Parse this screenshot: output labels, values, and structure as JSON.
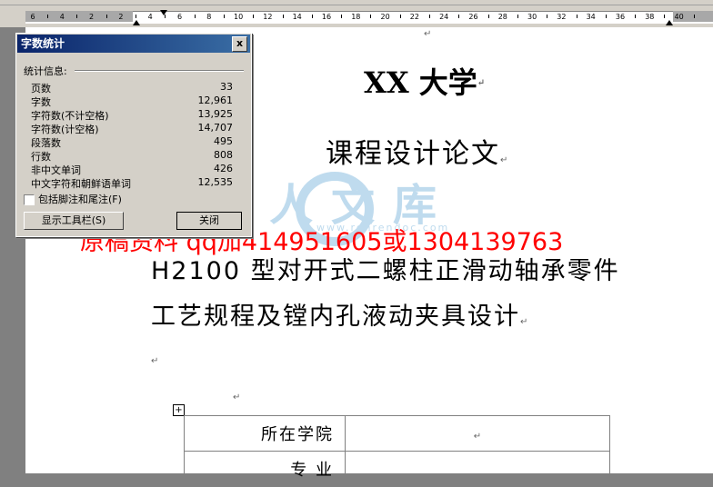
{
  "ruler": {
    "ticks": [
      "6",
      "4",
      "2",
      "2",
      "4",
      "6",
      "8",
      "10",
      "12",
      "14",
      "16",
      "18",
      "20",
      "22",
      "24",
      "26",
      "28",
      "30",
      "32",
      "34",
      "36",
      "38",
      "40"
    ]
  },
  "document": {
    "title_1": "XX 大学",
    "title_2": "课程设计论文",
    "watermark": "人人文库",
    "watermark_url": "www.renrendoc.com",
    "red_banner": "原稿资料  qq加414951605或1304139763",
    "subtitle_1": "H2100 型对开式二螺柱正滑动轴承零件",
    "subtitle_2": "工艺规程及镗内孔液动夹具设计",
    "table": {
      "rows": [
        {
          "label": "所在学院",
          "value": ""
        },
        {
          "label": "专    业",
          "value": ""
        }
      ]
    },
    "para_mark": "↵",
    "table_anchor": "+"
  },
  "dialog": {
    "title": "字数统计",
    "close_glyph": "x",
    "caption": "统计信息:",
    "stats": [
      {
        "label": "页数",
        "value": "33"
      },
      {
        "label": "字数",
        "value": "12,961"
      },
      {
        "label": "字符数(不计空格)",
        "value": "13,925"
      },
      {
        "label": "字符数(计空格)",
        "value": "14,707"
      },
      {
        "label": "段落数",
        "value": "495"
      },
      {
        "label": "行数",
        "value": "808"
      },
      {
        "label": "非中文单词",
        "value": "426"
      },
      {
        "label": "中文字符和朝鲜语单词",
        "value": "12,535"
      }
    ],
    "footnote_checkbox": "包括脚注和尾注(F)",
    "show_toolbar_button": "显示工具栏(S)",
    "close_button": "关闭"
  }
}
